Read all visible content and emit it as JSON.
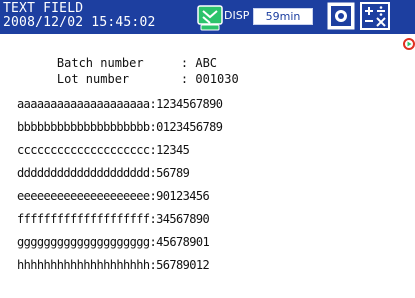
{
  "header": {
    "title_line1": "TEXT FIELD",
    "title_line2": "2008/12/02 15:45:02",
    "disp_label": "DISP",
    "interval": "59min",
    "icons": [
      "trend-cycle-icon",
      "snapshot-icon",
      "math-icon",
      "play-icon"
    ]
  },
  "colors": {
    "header_bg": "#1d3fa0",
    "icon_green": "#2cc36b",
    "play_red": "#e03020"
  },
  "info": {
    "batch_label": "Batch number",
    "batch_value": ": ABC",
    "lot_label": "Lot number",
    "lot_value": ": 001030"
  },
  "text_fields": [
    {
      "text": "aaaaaaaaaaaaaaaaaaaa:1234567890"
    },
    {
      "text": "bbbbbbbbbbbbbbbbbbbb:0123456789"
    },
    {
      "text": "cccccccccccccccccccc:12345"
    },
    {
      "text": "dddddddddddddddddddd:56789"
    },
    {
      "text": "eeeeeeeeeeeeeeeeeeee:90123456"
    },
    {
      "text": "ffffffffffffffffffff:34567890"
    },
    {
      "text": "gggggggggggggggggggg:45678901"
    },
    {
      "text": "hhhhhhhhhhhhhhhhhhhh:56789012"
    }
  ]
}
